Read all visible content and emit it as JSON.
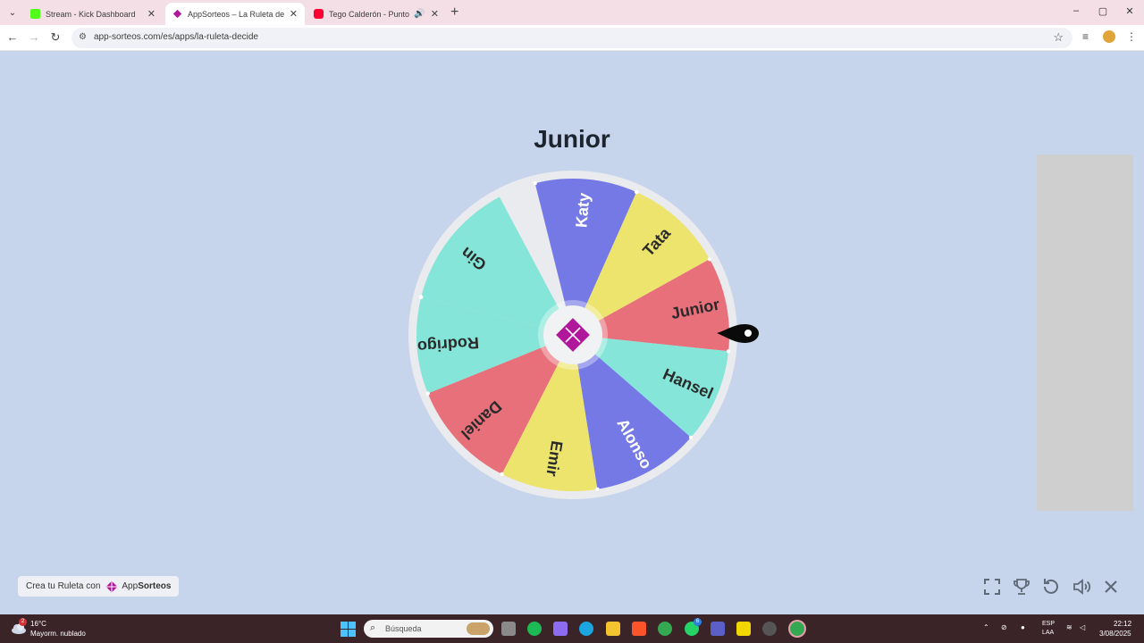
{
  "browser": {
    "tabs": [
      {
        "title": "Stream - Kick Dashboard",
        "favicon_color": "#53fc18",
        "active": false
      },
      {
        "title": "AppSorteos – La Ruleta de la Su",
        "favicon_color": "#b0179a",
        "active": true
      },
      {
        "title": "Tego Calderón - Punto y Ap",
        "favicon_color": "#ff0033",
        "active": false,
        "audio": true
      }
    ],
    "new_tab_label": "+",
    "url": "app-sorteos.com/es/apps/la-ruleta-decide",
    "window_controls": [
      "–",
      "▢",
      "✕"
    ]
  },
  "page": {
    "winner_name": "Junior",
    "wheel": {
      "segments": [
        {
          "label": "Katy",
          "color": "#7579e6",
          "text_color": "#ffffff"
        },
        {
          "label": "Tata",
          "color": "#ede46e",
          "text_color": "#2a2a2a"
        },
        {
          "label": "Junior",
          "color": "#e8707a",
          "text_color": "#2a2a2a"
        },
        {
          "label": "Hansel",
          "color": "#84e5d8",
          "text_color": "#2a2a2a"
        },
        {
          "label": "Alonso",
          "color": "#7579e6",
          "text_color": "#ffffff"
        },
        {
          "label": "Emir",
          "color": "#ede46e",
          "text_color": "#2a2a2a"
        },
        {
          "label": "Daniel",
          "color": "#e8707a",
          "text_color": "#2a2a2a"
        },
        {
          "label": "Rodrigo",
          "color": "#84e5d8",
          "text_color": "#2a2a2a"
        },
        {
          "label": "Gin",
          "color": "#84e5d8",
          "text_color": "#2a2a2a"
        }
      ],
      "rim_color": "#e9ebee",
      "center_color": "#f1f2f4",
      "logo_color": "#b0179a",
      "pointer_color": "#0a0a0a"
    },
    "promo": {
      "text": "Crea tu Ruleta con",
      "brand_prefix": "App",
      "brand_suffix": "Sorteos"
    },
    "controls": [
      "fullscreen-icon",
      "trophy-icon",
      "restart-icon",
      "volume-icon",
      "close-icon"
    ]
  },
  "taskbar": {
    "weather_badge": "2",
    "weather_temp": "16°C",
    "weather_desc": "Mayorm. nublado",
    "search_placeholder": "Búsqueda",
    "whatsapp_badge": "6",
    "lang_line1": "ESP",
    "lang_line2": "LAA",
    "time": "22:12",
    "date": "3/08/2025"
  }
}
